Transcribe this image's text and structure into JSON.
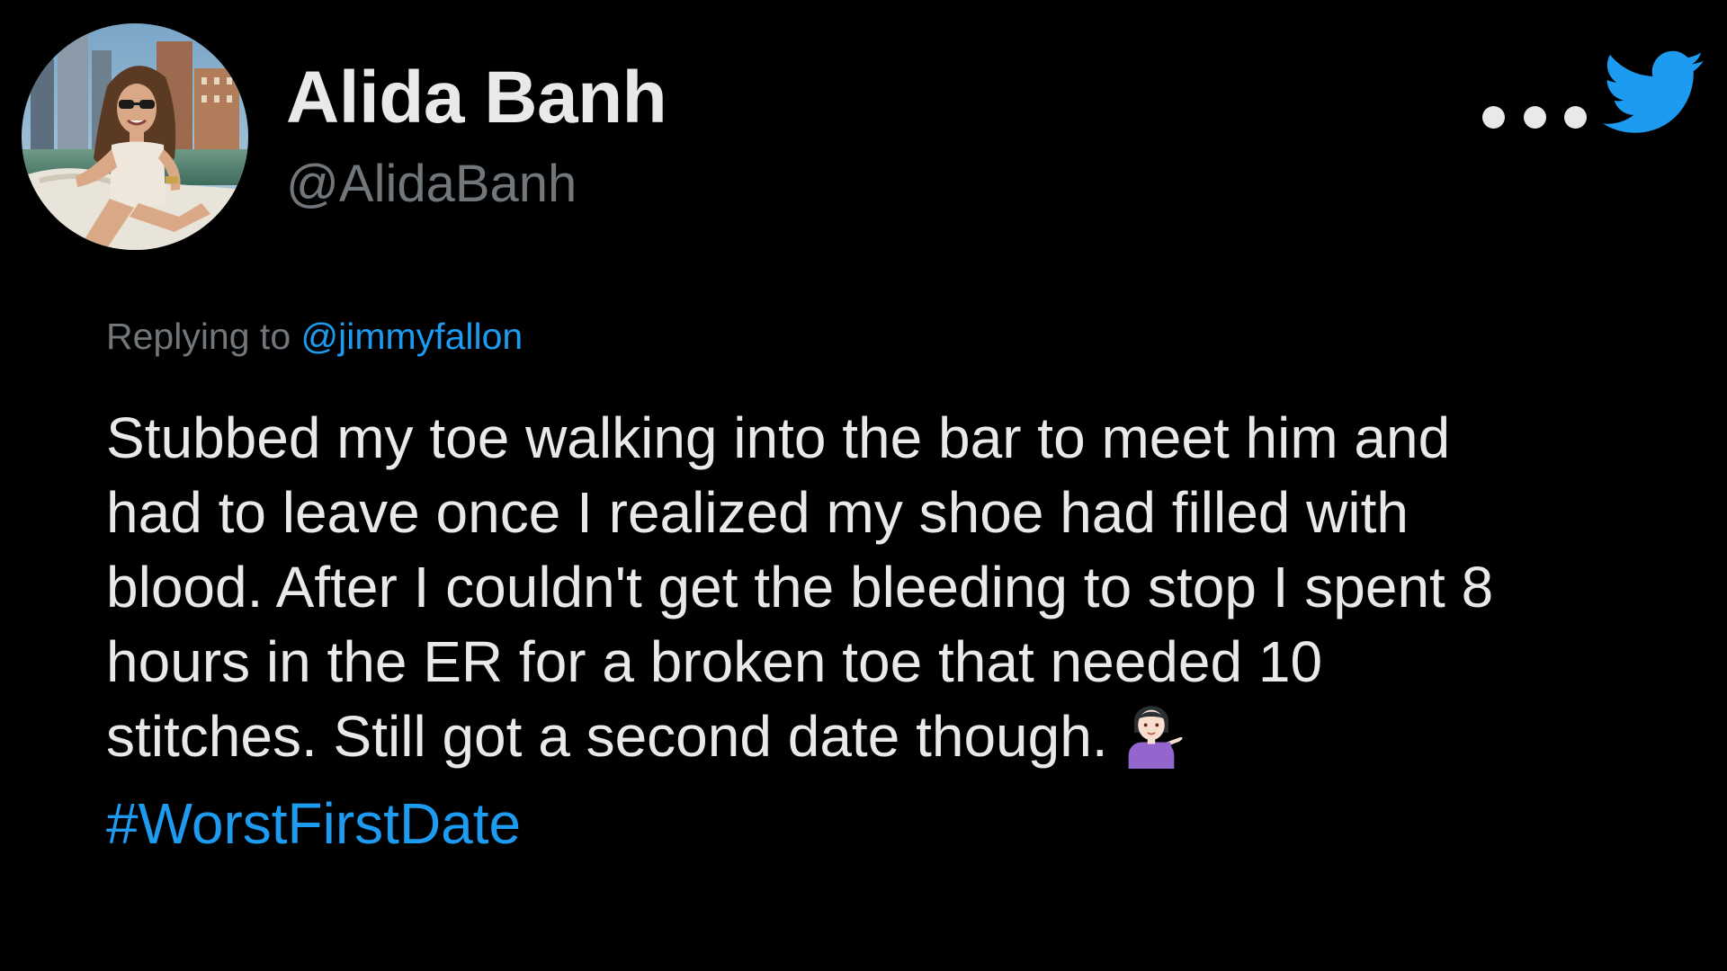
{
  "author": {
    "display_name": "Alida Banh",
    "handle": "@AlidaBanh",
    "avatar_icon": "profile-photo"
  },
  "header": {
    "more_icon": "more-options-icon",
    "logo_icon": "twitter-bird-icon",
    "logo_color": "#1d9bf0"
  },
  "reply_context": {
    "prefix": "Replying to",
    "mention": "@jimmyfallon"
  },
  "tweet": {
    "lines": [
      "Stubbed my toe walking into the bar to meet him and",
      "had to leave once I realized my shoe had filled with",
      "blood. After I couldn't get the bleeding to stop I spent 8",
      "hours in the ER for a broken toe that needed 10",
      "stitches. Still got a second date though."
    ],
    "emoji": "person-tipping-hand-emoji",
    "hashtag": "#WorstFirstDate"
  },
  "colors": {
    "background": "#000000",
    "primary_text": "#e7e9ea",
    "secondary_text": "#71767b",
    "accent": "#1d9bf0"
  }
}
